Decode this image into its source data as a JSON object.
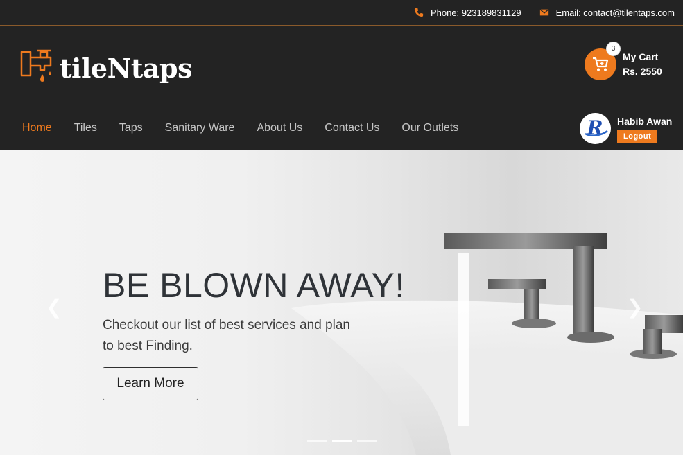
{
  "topbar": {
    "phone": "Phone: 923189831129",
    "email": "Email: contact@tilentaps.com",
    "phone_icon": "phone-icon",
    "email_icon": "envelope-icon"
  },
  "brand": {
    "name": "tileNtaps",
    "accent": "#ee7a1e",
    "bg": "#232323"
  },
  "cart": {
    "count": "3",
    "label": "My Cart",
    "total": "Rs. 2550"
  },
  "nav": {
    "items": [
      {
        "label": "Home",
        "active": true
      },
      {
        "label": "Tiles"
      },
      {
        "label": "Taps"
      },
      {
        "label": "Sanitary Ware"
      },
      {
        "label": "About Us"
      },
      {
        "label": "Contact Us"
      },
      {
        "label": "Our Outlets"
      }
    ]
  },
  "user": {
    "name": "Habib Awan",
    "logout": "Logout",
    "avatar_letter": "R"
  },
  "hero": {
    "title": "BE BLOWN AWAY!",
    "subtitle": "Checkout our list of best services and plan to best Finding.",
    "button": "Learn More",
    "prev_icon": "chevron-left-icon",
    "next_icon": "chevron-right-icon",
    "slides": 3,
    "active_slide": 2
  }
}
